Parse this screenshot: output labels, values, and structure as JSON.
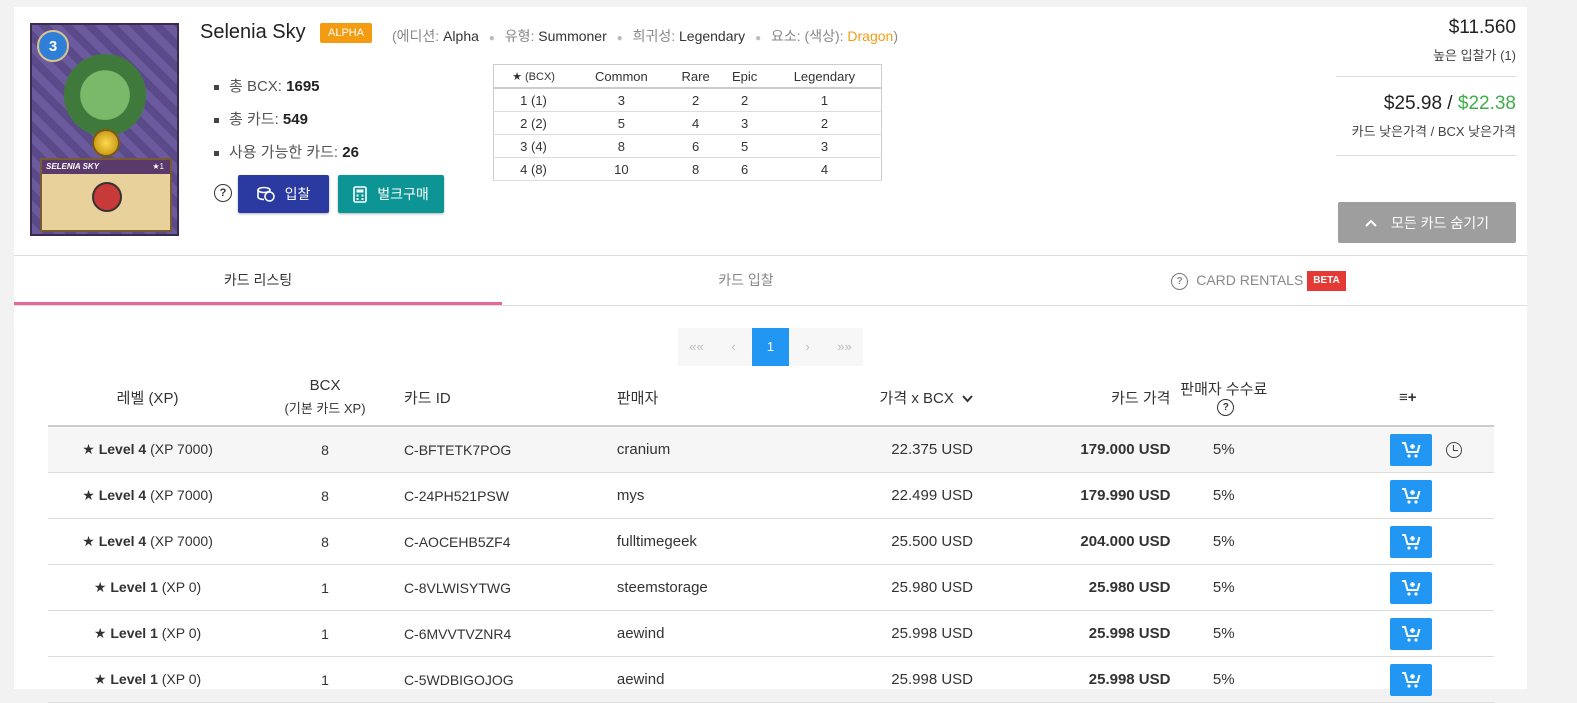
{
  "card": {
    "level_badge": "3",
    "plate_title": "SELENIA SKY",
    "plate_star": "★1",
    "name": "Selenia Sky",
    "edition_badge": "ALPHA",
    "meta": {
      "edition_label": "(에디션:",
      "edition_value": "Alpha",
      "type_label": "유형:",
      "type_value": "Summoner",
      "rarity_label": "희귀성:",
      "rarity_value": "Legendary",
      "element_label": "요소: (색상):",
      "element_value": "Dragon",
      "element_close": ")"
    },
    "stats": [
      {
        "label": "총 BCX:",
        "value": "1695"
      },
      {
        "label": "총 카드:",
        "value": "549"
      },
      {
        "label": "사용 가능한 카드:",
        "value": "26"
      }
    ],
    "buttons": {
      "bid": "입찰",
      "bulk": "벌크구매"
    }
  },
  "bcx_table": {
    "headers": [
      "★ (BCX)",
      "Common",
      "Rare",
      "Epic",
      "Legendary"
    ],
    "rows": [
      [
        "1 (1)",
        "3",
        "2",
        "2",
        "1"
      ],
      [
        "2 (2)",
        "5",
        "4",
        "3",
        "2"
      ],
      [
        "3 (4)",
        "8",
        "6",
        "5",
        "3"
      ],
      [
        "4 (8)",
        "10",
        "8",
        "6",
        "4"
      ]
    ]
  },
  "prices": {
    "top_bid": "$11.560",
    "top_bid_label": "높은 입찰가 (1)",
    "low_card": "$25.98",
    "separator": " / ",
    "low_bcx": "$22.38",
    "low_label": "카드 낮은가격 / BCX 낮은가격",
    "hide_button": "모든 카드 숨기기"
  },
  "tabs": {
    "listings": "카드 리스팅",
    "bids": "카드 입찰",
    "rentals": "CARD RENTALS",
    "beta": "BETA"
  },
  "pager": [
    "««",
    "‹",
    "1",
    "›",
    "»»"
  ],
  "columns": {
    "level": "레벨 (XP)",
    "bcx": "BCX",
    "bcx_sub": "(기본 카드 XP)",
    "id": "카드 ID",
    "seller": "판매자",
    "ppb": "가격 x BCX",
    "price": "카드 가격",
    "fee": "판매자 수수료"
  },
  "listings": [
    {
      "level": "Level 4",
      "xp": "(XP 7000)",
      "bcx": "8",
      "id": "C-BFTETK7POG",
      "seller": "cranium",
      "ppb": "22.375 USD",
      "price": "179.000 USD",
      "fee": "5%"
    },
    {
      "level": "Level 4",
      "xp": "(XP 7000)",
      "bcx": "8",
      "id": "C-24PH521PSW",
      "seller": "mys",
      "ppb": "22.499 USD",
      "price": "179.990 USD",
      "fee": "5%"
    },
    {
      "level": "Level 4",
      "xp": "(XP 7000)",
      "bcx": "8",
      "id": "C-AOCEHB5ZF4",
      "seller": "fulltimegeek",
      "ppb": "25.500 USD",
      "price": "204.000 USD",
      "fee": "5%"
    },
    {
      "level": "Level 1",
      "xp": "(XP 0)",
      "bcx": "1",
      "id": "C-8VLWISYTWG",
      "seller": "steemstorage",
      "ppb": "25.980 USD",
      "price": "25.980 USD",
      "fee": "5%"
    },
    {
      "level": "Level 1",
      "xp": "(XP 0)",
      "bcx": "1",
      "id": "C-6MVVTVZNR4",
      "seller": "aewind",
      "ppb": "25.998 USD",
      "price": "25.998 USD",
      "fee": "5%"
    },
    {
      "level": "Level 1",
      "xp": "(XP 0)",
      "bcx": "1",
      "id": "C-5WDBIGOJOG",
      "seller": "aewind",
      "ppb": "25.998 USD",
      "price": "25.998 USD",
      "fee": "5%"
    }
  ]
}
